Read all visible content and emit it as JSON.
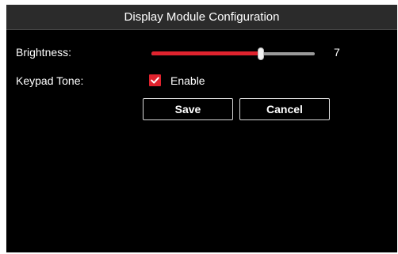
{
  "dialog": {
    "title": "Display Module Configuration"
  },
  "brightness": {
    "label": "Brightness:",
    "value": "7",
    "level_fraction": 0.67,
    "fill_color": "#e0232e"
  },
  "keypad_tone": {
    "label": "Keypad Tone:",
    "checked": true,
    "option_label": "Enable",
    "icon": "checkmark-icon",
    "accent_color": "#e0232e"
  },
  "buttons": {
    "save_label": "Save",
    "cancel_label": "Cancel"
  }
}
